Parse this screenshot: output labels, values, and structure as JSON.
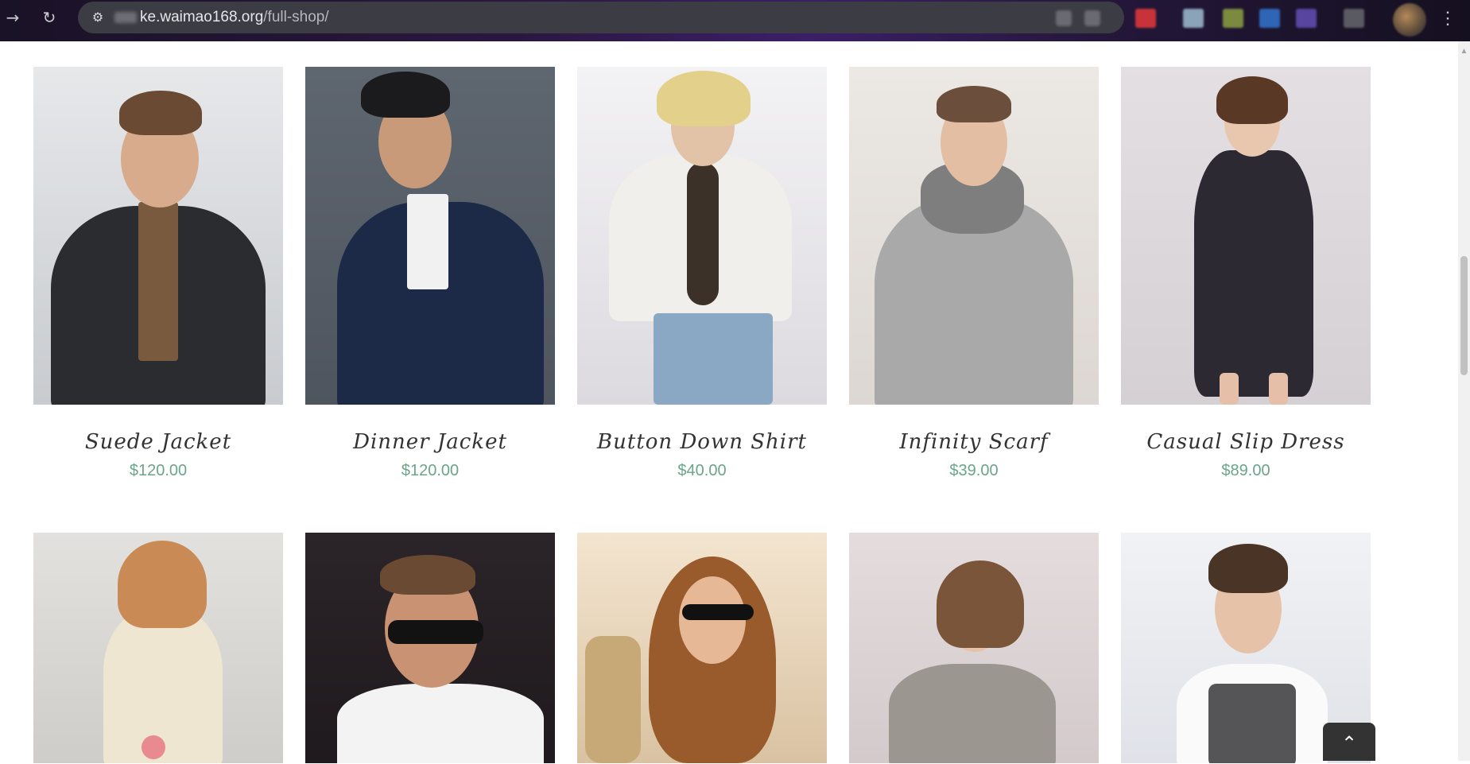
{
  "browser": {
    "url_host": "ke.waimao168.org",
    "url_path": "/full-shop/",
    "icons": [
      "back-arrow-icon",
      "reload-icon",
      "site-settings-icon",
      "profile-avatar",
      "chrome-menu-icon"
    ]
  },
  "products_row1": [
    {
      "name": "Suede Jacket",
      "price": "$120.00"
    },
    {
      "name": "Dinner Jacket",
      "price": "$120.00"
    },
    {
      "name": "Button Down Shirt",
      "price": "$40.00"
    },
    {
      "name": "Infinity Scarf",
      "price": "$39.00"
    },
    {
      "name": "Casual Slip Dress",
      "price": "$89.00"
    }
  ],
  "products_row2_count": 5,
  "colors": {
    "price": "#6aa58a",
    "title": "#333333",
    "back_to_top": "#333333"
  }
}
